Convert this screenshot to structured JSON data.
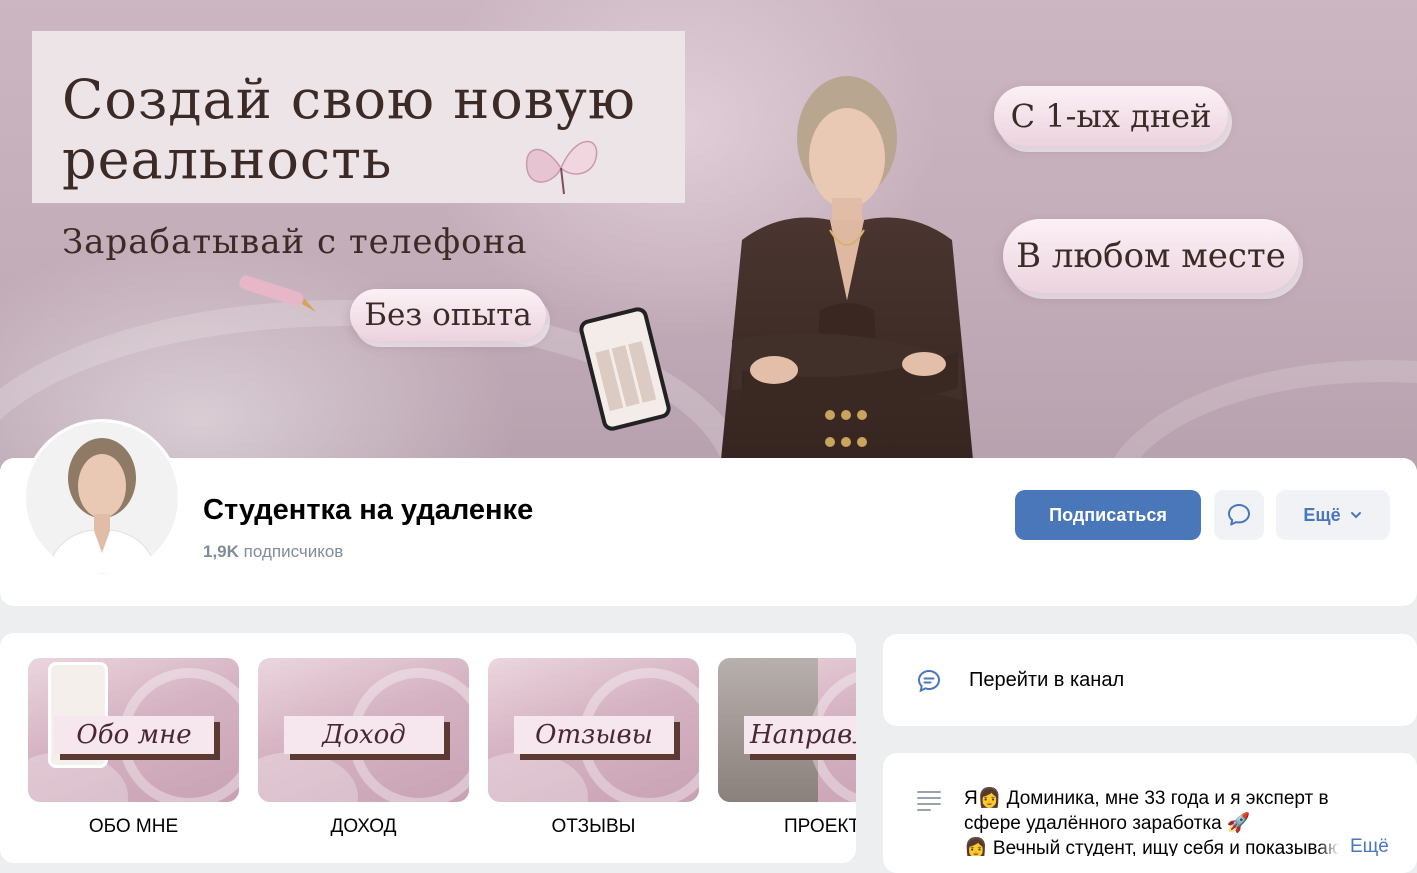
{
  "cover": {
    "headline_line1": "Создай свою новую",
    "headline_line2": "реальность",
    "subline": "Зарабатывай с телефона",
    "pill_no_experience": "Без опыта",
    "pill_first_days": "С 1-ых дней",
    "pill_anywhere": "В любом месте"
  },
  "profile": {
    "name": "Студентка на удаленке",
    "followers_count": "1,9K",
    "followers_label": "подписчиков",
    "subscribe_label": "Подписаться",
    "more_label": "Ещё"
  },
  "albums": [
    {
      "label": "Обо мне",
      "caption": "ОБО МНЕ"
    },
    {
      "label": "Доход",
      "caption": "ДОХОД"
    },
    {
      "label": "Отзывы",
      "caption": "ОТЗЫВЫ"
    },
    {
      "label": "Направл",
      "caption": "ПРОЕКТ"
    }
  ],
  "channel": {
    "label": "Перейти в канал"
  },
  "description": {
    "line1": "Я👩 Доминика, мне 33 года и я эксперт в",
    "line2": "сфере удалённого заработка 🚀",
    "line3": "👩 Вечный студент, ищу себя и показываю",
    "more": "Ещё"
  },
  "colors": {
    "accent": "#4a77b9",
    "secondary_bg": "#f0f2f5",
    "muted_text": "#818c99",
    "page_bg": "#edeef0"
  },
  "icons": {
    "message": "message-bubble-icon",
    "chevron": "chevron-down-icon",
    "channel": "chat-bubble-icon",
    "description": "text-lines-icon"
  }
}
